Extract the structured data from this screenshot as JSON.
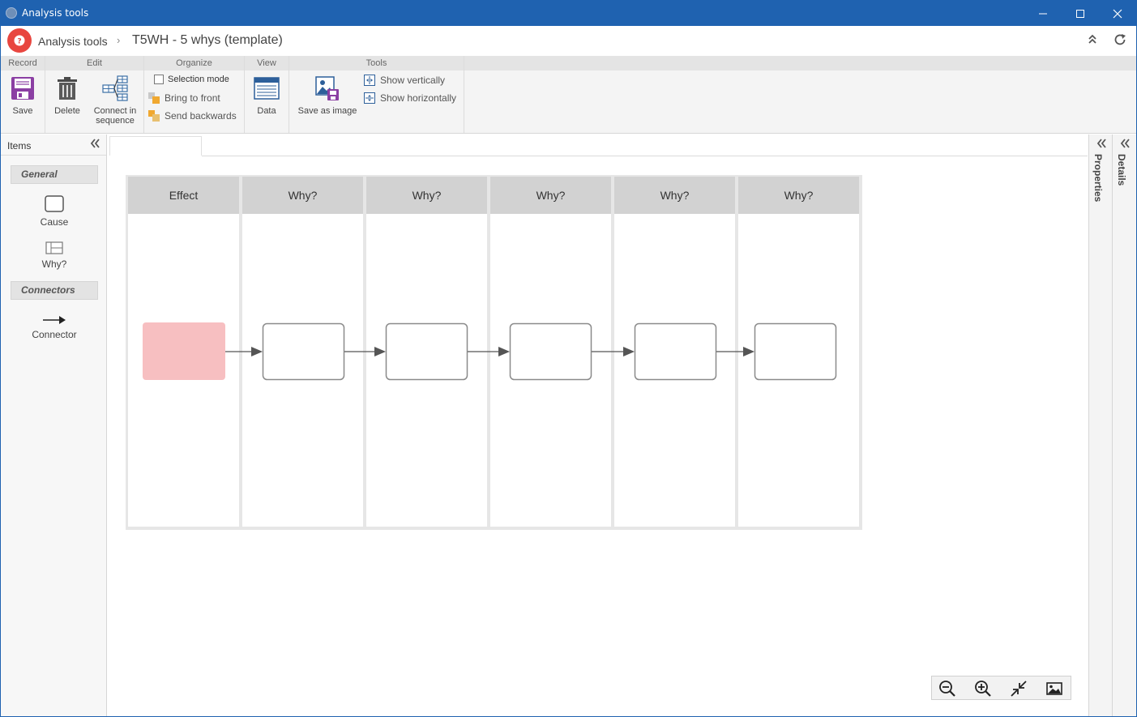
{
  "window": {
    "title": "Analysis tools",
    "controls": {
      "minimize": "—",
      "maximize": "☐",
      "close": "✕"
    }
  },
  "header": {
    "breadcrumb_root": "Analysis tools",
    "separator": "›",
    "page_title": "T5WH - 5 whys (template)",
    "collapse_glyph": "⌃",
    "refresh_glyph": "⟳"
  },
  "ribbon": {
    "groups": {
      "record": "Record",
      "edit": "Edit",
      "organize": "Organize",
      "view": "View",
      "tools": "Tools"
    },
    "save": "Save",
    "delete": "Delete",
    "connect_line1": "Connect in",
    "connect_line2": "sequence",
    "selection_mode": "Selection mode",
    "bring_to_front": "Bring to front",
    "send_backwards": "Send backwards",
    "data": "Data",
    "save_as_image": "Save as image",
    "show_vertically": "Show vertically",
    "show_horizontally": "Show horizontally"
  },
  "items_panel": {
    "title": "Items",
    "collapse_glyph": "«",
    "general": "General",
    "cause": "Cause",
    "why": "Why?",
    "connectors": "Connectors",
    "connector": "Connector"
  },
  "diagram": {
    "lanes": [
      "Effect",
      "Why?",
      "Why?",
      "Why?",
      "Why?",
      "Why?"
    ],
    "effect_fill": "#f7bfc1",
    "node_border": "#8a8a8a",
    "arrow_color": "#555555"
  },
  "right_panels": {
    "properties": "Properties",
    "details": "Details",
    "collapse_glyph": "«"
  },
  "colors": {
    "titlebar": "#1f62b0",
    "logo": "#e8463f",
    "ribbon_bg": "#f4f4f4",
    "lane_header": "#d2d2d2"
  }
}
